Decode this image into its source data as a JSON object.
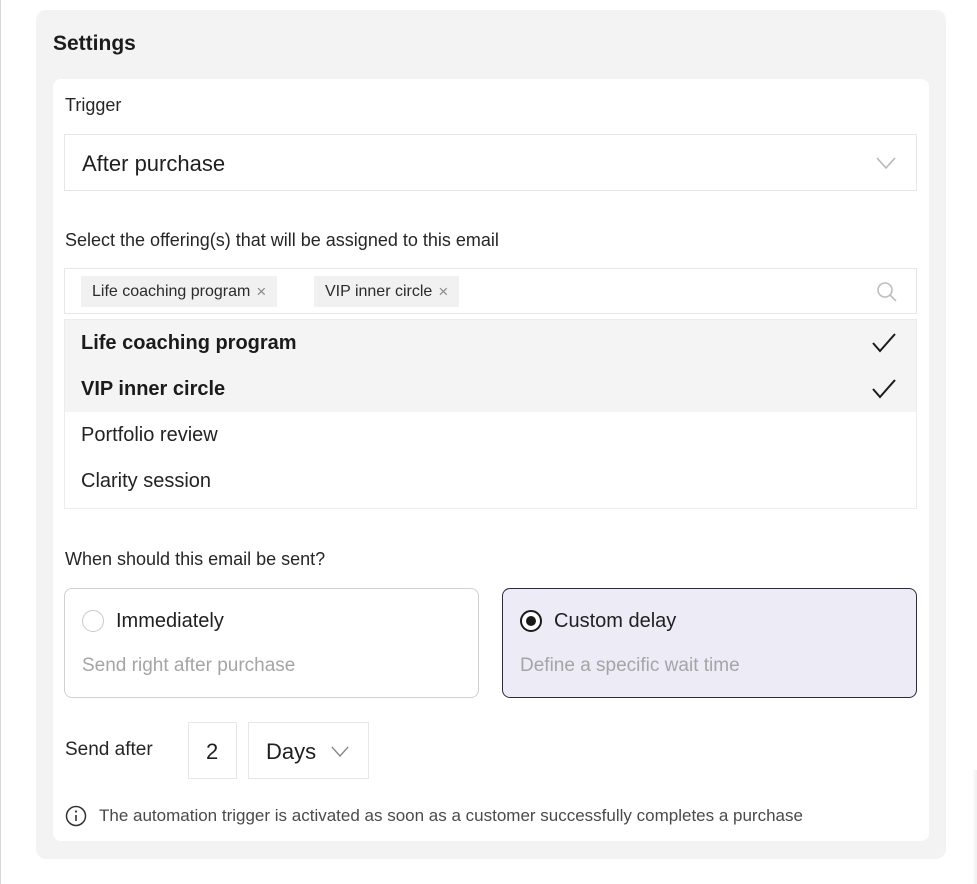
{
  "settings": {
    "title": "Settings",
    "trigger": {
      "label": "Trigger",
      "value": "After purchase"
    },
    "offerings": {
      "label": "Select the offering(s) that will be assigned to this email",
      "chips": [
        "Life coaching program",
        "VIP inner circle"
      ],
      "chip_remove_glyph": "×",
      "options": [
        {
          "label": "Life coaching program",
          "selected": true
        },
        {
          "label": "VIP inner circle",
          "selected": true
        },
        {
          "label": "Portfolio review",
          "selected": false
        },
        {
          "label": "Clarity session",
          "selected": false
        }
      ]
    },
    "send_time": {
      "label": "When should this email be sent?",
      "options": [
        {
          "title": "Immediately",
          "description": "Send right after purchase",
          "selected": false
        },
        {
          "title": "Custom delay",
          "description": "Define a specific wait time",
          "selected": true
        }
      ]
    },
    "send_after": {
      "label": "Send after",
      "amount": "2",
      "unit": "Days"
    },
    "info": "The automation trigger is activated as soon as a customer successfully completes a purchase"
  },
  "colors": {
    "panel_bg": "#f3f3f3",
    "selected_card_bg": "#ecebf6",
    "selected_card_border": "#2c2b40",
    "muted_text": "#a5a5a5"
  },
  "icons": [
    "chevron-down-icon",
    "close-icon",
    "search-icon",
    "checkmark-icon",
    "info-icon"
  ]
}
